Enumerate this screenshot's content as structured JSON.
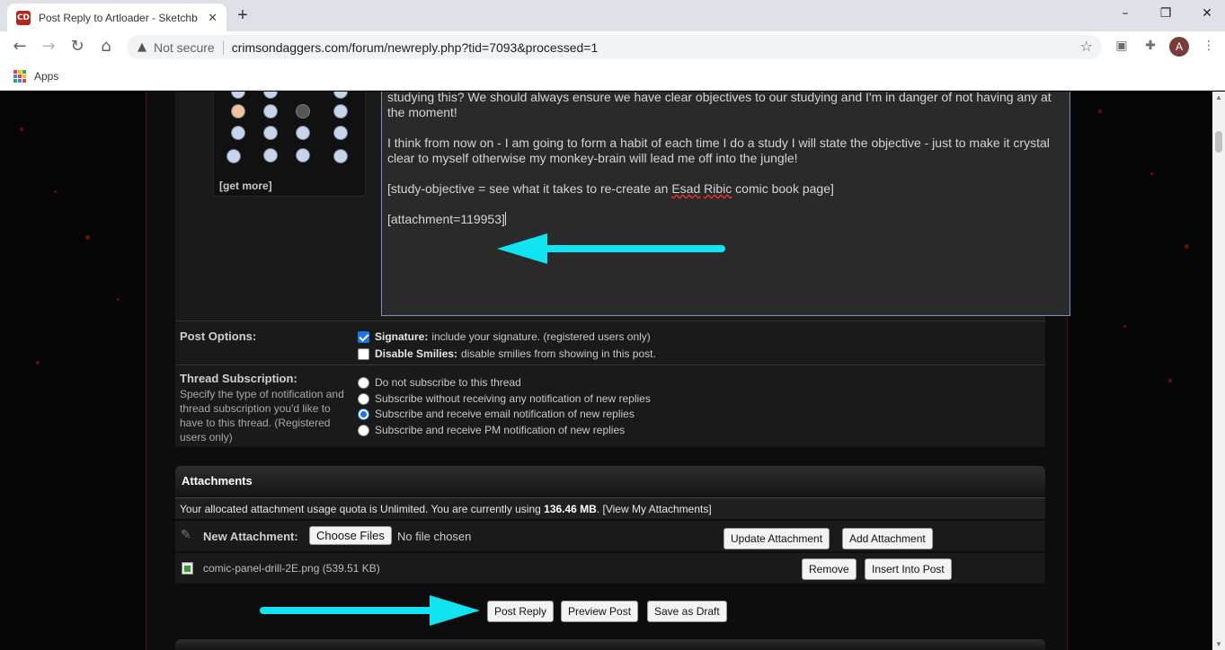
{
  "browser": {
    "tab_title": "Post Reply to Artloader - Sketchb",
    "favicon_text": "CD",
    "not_secure": "Not secure",
    "url": "crimsondaggers.com/forum/newreply.php?tid=7093&processed=1",
    "profile_initial": "A",
    "bookmark_apps": "Apps"
  },
  "smilies": {
    "get_more": "[get more]"
  },
  "editor": {
    "paragraphs": [
      "studying this?  We should always ensure we have clear objectives to our studying and I'm in danger of not having any at the moment!",
      "I think from now on - I am going to form a habit of each time I do a study I will state the objective - just to make it crystal clear to myself otherwise my monkey-brain will lead me off into the jungle!"
    ],
    "objective_prefix": "[study-objective = see what it takes to re-create an ",
    "objective_name_1": "Esad",
    "objective_name_2": "Ribic",
    "objective_suffix": " comic book page]",
    "attachment_tag": "[attachment=119953]"
  },
  "post_options": {
    "label": "Post Options:",
    "signature_label": "Signature:",
    "signature_desc": "include your signature. (registered users only)",
    "signature_checked": true,
    "disable_smilies_label": "Disable Smilies:",
    "disable_smilies_desc": "disable smilies from showing in this post.",
    "disable_smilies_checked": false
  },
  "subscription": {
    "label": "Thread Subscription:",
    "desc": "Specify the type of notification and thread subscription you'd like to have to this thread. (Registered users only)",
    "options": [
      "Do not subscribe to this thread",
      "Subscribe without receiving any notification of new replies",
      "Subscribe and receive email notification of new replies",
      "Subscribe and receive PM notification of new replies"
    ],
    "selected_index": 2
  },
  "attachments": {
    "title": "Attachments",
    "quota_prefix": "Your allocated attachment usage quota is Unlimited. You are currently using ",
    "quota_used": "136.46 MB",
    "quota_suffix": ". [View My Attachments]",
    "new_label": "New Attachment:",
    "choose_files": "Choose Files",
    "no_file": "No file chosen",
    "update_btn": "Update Attachment",
    "add_btn": "Add Attachment",
    "file_name": "comic-panel-drill-2E.png (539.51 KB)",
    "remove_btn": "Remove",
    "insert_btn": "Insert Into Post"
  },
  "actions": {
    "post_reply": "Post Reply",
    "preview_post": "Preview Post",
    "save_draft": "Save as Draft"
  },
  "colors": {
    "annotation_arrow": "#12e3f0",
    "accent": "#1a73e8"
  }
}
